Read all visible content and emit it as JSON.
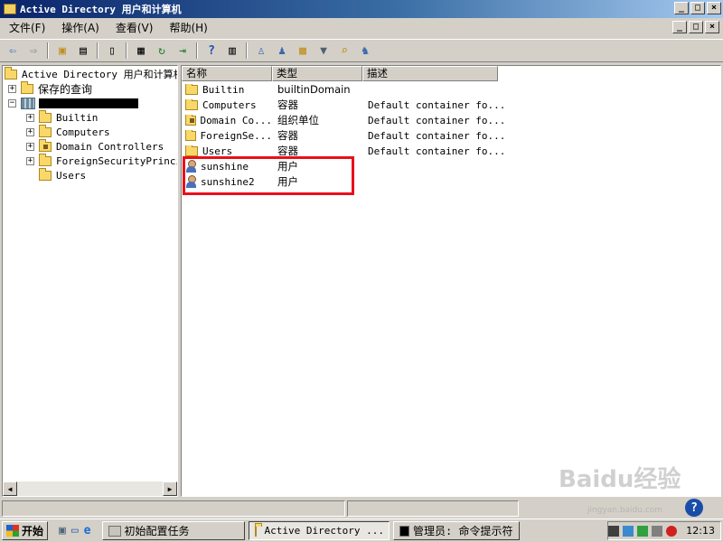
{
  "window": {
    "title": "Active Directory 用户和计算机",
    "controls": [
      "_",
      "□",
      "×"
    ]
  },
  "menu": [
    "文件(F)",
    "操作(A)",
    "查看(V)",
    "帮助(H)"
  ],
  "tree": {
    "root": "Active Directory 用户和计算机",
    "saved_queries": "保存的查询",
    "domain_expanded": true,
    "children": [
      "Builtin",
      "Computers",
      "Domain Controllers",
      "ForeignSecurityPrincip",
      "Users"
    ]
  },
  "list": {
    "columns": [
      "名称",
      "类型",
      "描述"
    ],
    "rows": [
      {
        "name": "Builtin",
        "type": "builtinDomain",
        "desc": "",
        "icon": "folder-icon"
      },
      {
        "name": "Computers",
        "type": "容器",
        "desc": "Default container fo...",
        "icon": "folder-icon"
      },
      {
        "name": "Domain Co...",
        "type": "组织单位",
        "desc": "Default container fo...",
        "icon": "ou-icon"
      },
      {
        "name": "ForeignSe...",
        "type": "容器",
        "desc": "Default container fo...",
        "icon": "folder-icon"
      },
      {
        "name": "Users",
        "type": "容器",
        "desc": "Default container fo...",
        "icon": "folder-icon"
      },
      {
        "name": "sunshine",
        "type": "用户",
        "desc": "",
        "icon": "user-icon"
      },
      {
        "name": "sunshine2",
        "type": "用户",
        "desc": "",
        "icon": "user-icon"
      }
    ],
    "highlight_color": "#e8101a"
  },
  "taskbar": {
    "start": "开始",
    "tasks": [
      {
        "label": "初始配置任务",
        "active": false
      },
      {
        "label": "Active Directory ...",
        "active": true
      },
      {
        "label": "管理员: 命令提示符",
        "active": false
      }
    ],
    "clock": "12:13"
  },
  "watermark": {
    "text": "Baidu经验",
    "sub": "jingyan.baidu.com"
  }
}
